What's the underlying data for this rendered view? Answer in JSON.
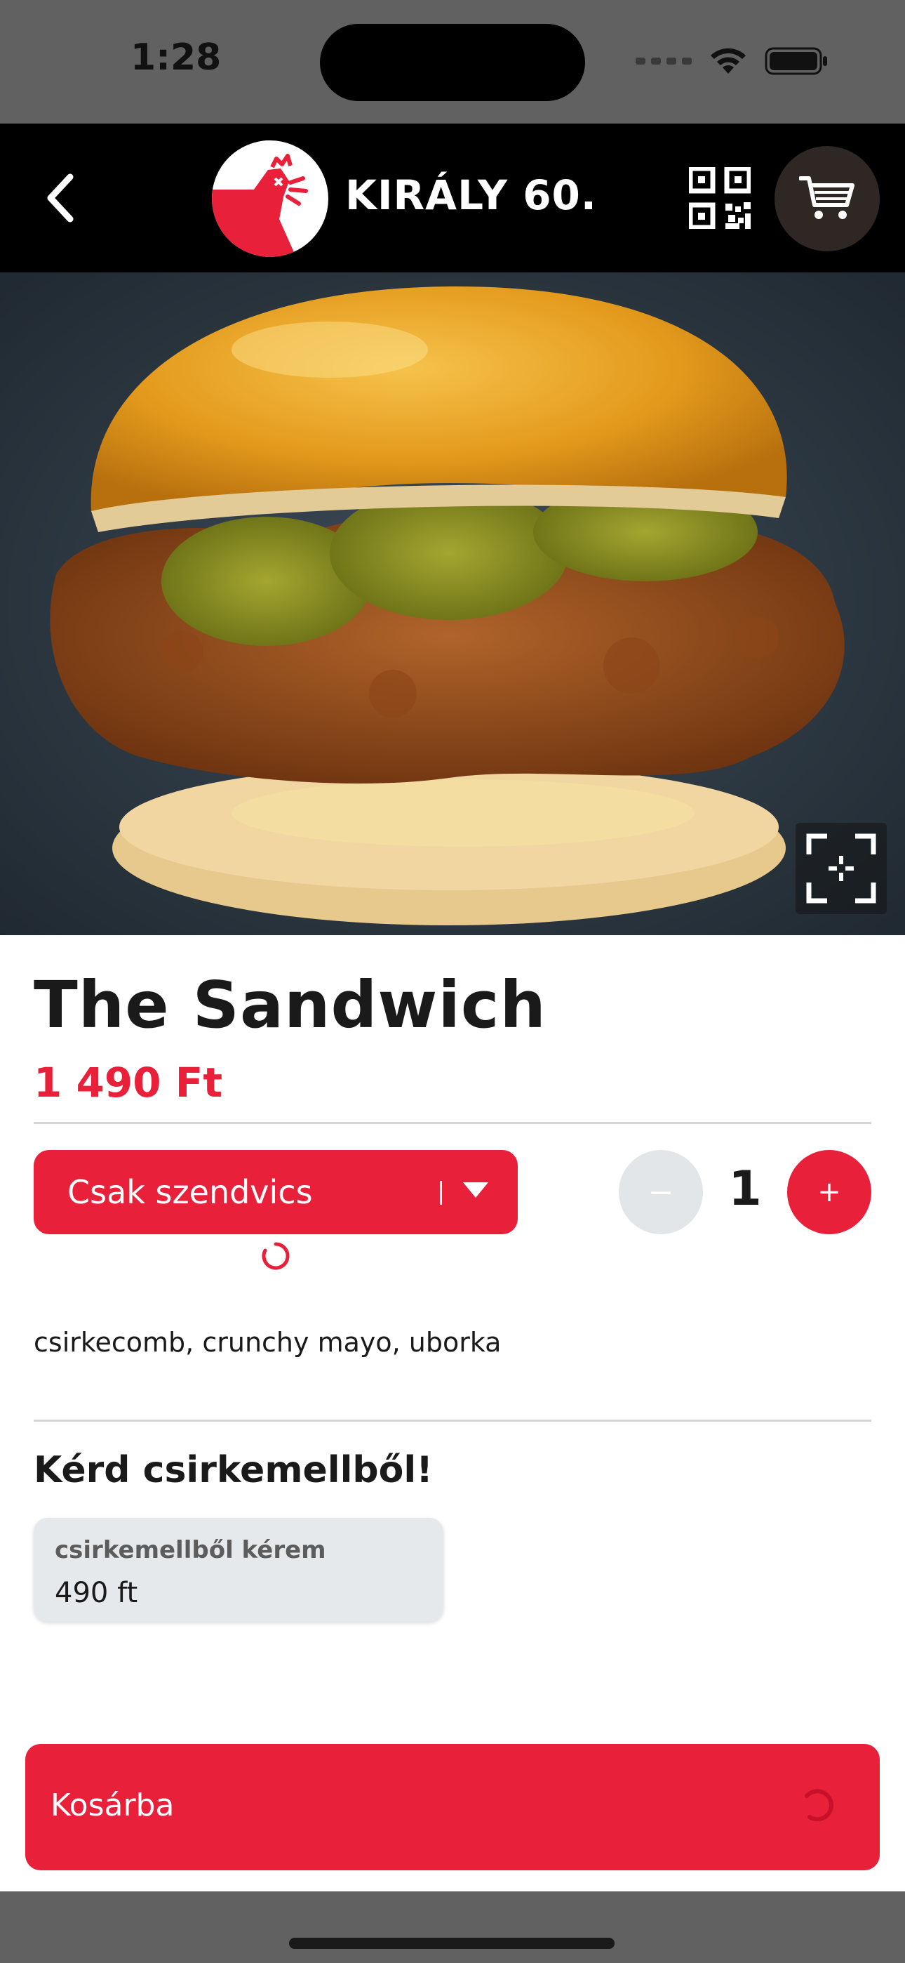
{
  "status_bar": {
    "time": "1:28"
  },
  "header": {
    "title": "KIRÁLY 60."
  },
  "product": {
    "name": "The Sandwich",
    "price": "1 490 Ft",
    "variant": "Csak szendvics",
    "quantity": "1",
    "quantity_minus": "−",
    "quantity_plus": "+",
    "description": "csirkecomb, crunchy mayo, uborka"
  },
  "addons": {
    "title": "Kérd csirkemellből!",
    "items": [
      {
        "name": "csirkemellből kérem",
        "price": "490 ft"
      }
    ]
  },
  "actions": {
    "add_to_cart": "Kosárba"
  },
  "colors": {
    "accent": "#e8203a",
    "header_bg": "#000000",
    "status_bg": "#616161"
  }
}
